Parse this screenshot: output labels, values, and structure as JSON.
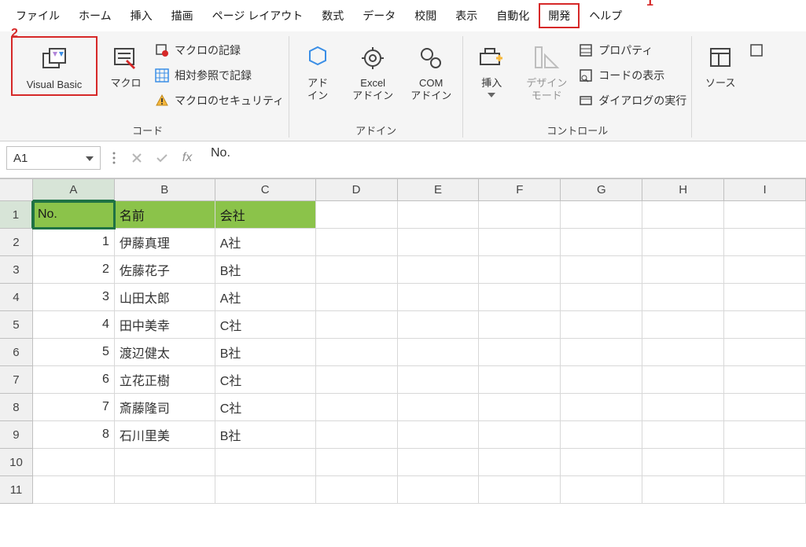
{
  "callouts": {
    "one": "1",
    "two": "2"
  },
  "menu": {
    "items": [
      "ファイル",
      "ホーム",
      "挿入",
      "描画",
      "ページ レイアウト",
      "数式",
      "データ",
      "校閲",
      "表示",
      "自動化",
      "開発",
      "ヘルプ"
    ],
    "highlighted_index": 10
  },
  "ribbon": {
    "group_code": {
      "label": "コード",
      "visual_basic": "Visual Basic",
      "macro": "マクロ",
      "record_macro": "マクロの記録",
      "relative_ref": "相対参照で記録",
      "macro_security": "マクロのセキュリティ"
    },
    "group_addins": {
      "label": "アドイン",
      "addin": "アド\nイン",
      "excel_addin": "Excel\nアドイン",
      "com_addin": "COM\nアドイン"
    },
    "group_controls": {
      "label": "コントロール",
      "insert": "挿入",
      "design_mode": "デザイン\nモード",
      "properties": "プロパティ",
      "view_code": "コードの表示",
      "run_dialog": "ダイアログの実行"
    },
    "group_xml": {
      "source": "ソース"
    }
  },
  "formula_bar": {
    "name_box": "A1",
    "formula": "No."
  },
  "grid": {
    "columns": [
      "A",
      "B",
      "C",
      "D",
      "E",
      "F",
      "G",
      "H",
      "I"
    ],
    "row_numbers": [
      "1",
      "2",
      "3",
      "4",
      "5",
      "6",
      "7",
      "8",
      "9",
      "10",
      "11"
    ],
    "header_row": {
      "no": "No.",
      "name": "名前",
      "company": "会社"
    },
    "rows": [
      {
        "no": "1",
        "name": "伊藤真理",
        "company": "A社"
      },
      {
        "no": "2",
        "name": "佐藤花子",
        "company": "B社"
      },
      {
        "no": "3",
        "name": "山田太郎",
        "company": "A社"
      },
      {
        "no": "4",
        "name": "田中美幸",
        "company": "C社"
      },
      {
        "no": "5",
        "name": "渡辺健太",
        "company": "B社"
      },
      {
        "no": "6",
        "name": "立花正樹",
        "company": "C社"
      },
      {
        "no": "7",
        "name": "斎藤隆司",
        "company": "C社"
      },
      {
        "no": "8",
        "name": "石川里美",
        "company": "B社"
      }
    ]
  }
}
